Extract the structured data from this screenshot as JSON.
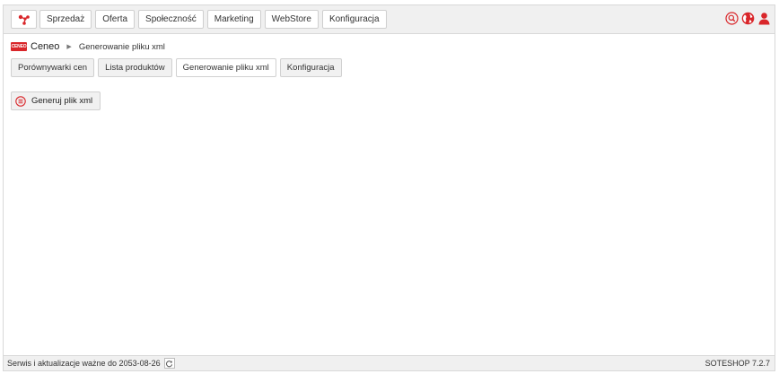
{
  "app": {
    "logo_icon": "soteshop-molecule-icon",
    "accent_color": "#d9262a"
  },
  "top_menu": {
    "items": [
      {
        "label": "Sprzedaż"
      },
      {
        "label": "Oferta"
      },
      {
        "label": "Społeczność"
      },
      {
        "label": "Marketing"
      },
      {
        "label": "WebStore"
      },
      {
        "label": "Konfiguracja"
      }
    ],
    "icons": [
      "search-icon",
      "globe-icon",
      "user-icon"
    ]
  },
  "breadcrumb": {
    "logo_text": "CENEO",
    "app_name": "Ceneo",
    "current_page": "Generowanie pliku xml"
  },
  "tabs": [
    {
      "label": "Porównywarki cen",
      "active": false
    },
    {
      "label": "Lista produktów",
      "active": false
    },
    {
      "label": "Generowanie pliku xml",
      "active": true
    },
    {
      "label": "Konfiguracja",
      "active": false
    }
  ],
  "actions": {
    "generate_label": "Generuj plik xml",
    "generate_icon": "list-circle-icon"
  },
  "footer": {
    "service_text": "Serwis i aktualizacje ważne do 2053-08-26",
    "version": "SOTESHOP 7.2.7"
  }
}
